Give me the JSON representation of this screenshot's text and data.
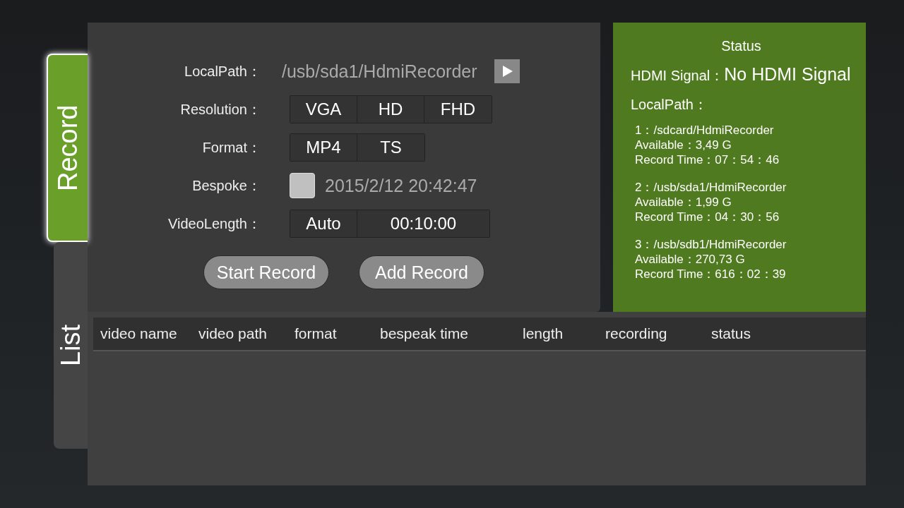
{
  "tabs": [
    {
      "label": "Record",
      "selected": true
    },
    {
      "label": "List",
      "selected": false
    }
  ],
  "form": {
    "rows": [
      {
        "kind": "path",
        "label": "LocalPath：",
        "value": "/usb/sda1/HdmiRecorder"
      },
      {
        "kind": "segmented",
        "label": "Resolution：",
        "options": [
          "VGA",
          "HD",
          "FHD"
        ]
      },
      {
        "kind": "segmented",
        "label": "Format：",
        "options": [
          "MP4",
          "TS"
        ]
      },
      {
        "kind": "checkbox",
        "label": "Bespoke：",
        "checked": false,
        "value": "2015/2/12 20:42:47"
      },
      {
        "kind": "segmented",
        "label": "VideoLength：",
        "options": [
          "Auto",
          "00:10:00"
        ]
      }
    ],
    "buttons": [
      "Start Record",
      "Add Record"
    ]
  },
  "status": {
    "title": "Status",
    "hdmi_label": "HDMI Signal：",
    "hdmi_value": "No HDMI Signal",
    "path_label": "LocalPath：",
    "paths": [
      {
        "path": "1：/sdcard/HdmiRecorder",
        "available": "Available：3,49 G",
        "record_time": "Record Time：07：54：46"
      },
      {
        "path": "2：/usb/sda1/HdmiRecorder",
        "available": "Available：1,99 G",
        "record_time": "Record Time：04：30：56"
      },
      {
        "path": "3：/usb/sdb1/HdmiRecorder",
        "available": "Available：270,73 G",
        "record_time": "Record Time：616：02：39"
      }
    ]
  },
  "table": {
    "columns": [
      "video name",
      "video path",
      "format",
      "bespeak time",
      "length",
      "recording",
      "status"
    ]
  }
}
